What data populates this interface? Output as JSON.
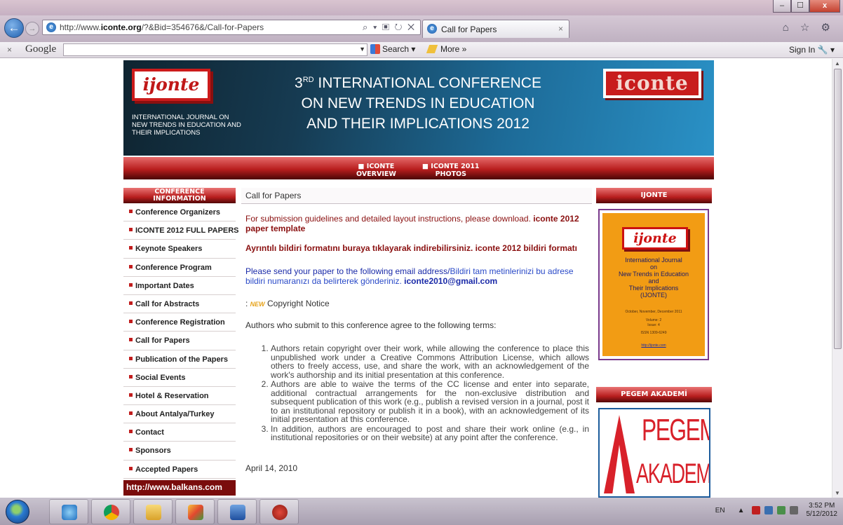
{
  "browser": {
    "url_prefix": "http://www.",
    "url_domain": "iconte.org",
    "url_rest": "/?&Bid=354676&/Call-for-Papers",
    "address_tools": "⌕ ▾ ▣ ↻ ✕",
    "tab_title": "Call for Papers",
    "tab_close": "×",
    "right_icons": "⌂ ☆ ⚙",
    "window_buttons": [
      "–",
      "☐",
      "x"
    ]
  },
  "google_toolbar": {
    "close": "×",
    "logo": "Google",
    "search_label": "Search ▾",
    "more_label": "More »",
    "sign_in": "Sign In 🔧 ▾"
  },
  "banner": {
    "ijonte_logo": "ijonte",
    "ijonte_subtitle": "INTERNATIONAL JOURNAL ON NEW TRENDS IN EDUCATION AND THEIR IMPLICATIONS",
    "title_prefix": "3",
    "title_sup": "RD",
    "title_line1": " INTERNATIONAL CONFERENCE",
    "title_line2": "ON NEW TRENDS IN EDUCATION",
    "title_line3": "AND THEIR IMPLICATIONS 2012",
    "iconte_logo": "iconte"
  },
  "menu": {
    "items": [
      {
        "line1": "■ ICONTE",
        "line2": "OVERVIEW"
      },
      {
        "line1": "■ ICONTE 2011",
        "line2": "PHOTOS"
      }
    ]
  },
  "sidebar": {
    "heading_line1": "CONFERENCE",
    "heading_line2": "INFORMATION",
    "items": [
      "Conference Organizers",
      "ICONTE 2012 FULL PAPERS",
      "Keynote Speakers",
      "Conference Program",
      "Important Dates",
      "Call for Abstracts",
      "Conference Registration",
      "Call for Papers",
      "Publication of the Papers",
      "Social Events",
      "Hotel & Reservation",
      "About Antalya/Turkey",
      "Contact",
      "Sponsors",
      "Accepted Papers"
    ],
    "footer": "http://www.balkans.com"
  },
  "main": {
    "panel_title": "Call for Papers",
    "p1_text": "For submission guidelines and detailed layout instructions, please download. ",
    "p1_link": "iconte 2012 paper template",
    "p2_text": "Ayrıntılı bildiri formatını buraya tıklayarak indirebilirsiniz. iconte 2012 bildiri formatı",
    "p3_text_a": "Please send your paper to the following email address/",
    "p3_text_b": "Bildiri tam metinlerinizi bu adrese bildiri numaranızı da belirterek gönderiniz. ",
    "p3_email": "iconte2010@gmail.com",
    "copyright_prefix": ": ",
    "copyright_new": "NEW",
    "copyright_label": " Copyright Notice",
    "agree_text": "Authors who submit to this conference agree to the following terms:",
    "terms": [
      "Authors retain copyright over their work, while allowing the conference to place this unpublished work under a Creative Commons Attribution License, which allows others to freely access, use, and share the work, with an acknowledgement of the work's authorship and its initial presentation at this conference.",
      "Authors are able to waive the terms of the CC license and enter into separate, additional contractual arrangements for the non-exclusive distribution and subsequent publication of this work (e.g., publish a revised version in a journal, post it to an institutional repository or publish it in a book), with an acknowledgement of its initial presentation at this conference.",
      "In addition, authors are encouraged to post and share their work online (e.g., in institutional repositories or on their website) at any point after the conference."
    ],
    "date": "April 14, 2010"
  },
  "right": {
    "ijonte_head": "IJONTE",
    "journal_logo": "ijonte",
    "journal_l1": "International Journal",
    "journal_l2": "on",
    "journal_l3": "New Trends in Education",
    "journal_l4": "and",
    "journal_l5": "Their Implications",
    "journal_l6": "(IJONTE)",
    "journal_issue": "October, November, December 2011",
    "journal_vol": "Volume: 2",
    "journal_iss": "Issue: 4",
    "journal_issn": "ISSN 1309-6249",
    "journal_url": "http://ijonte.com",
    "pegem_head": "PEGEM AKADEMİ",
    "pegem_t1": "PEGEM",
    "pegem_t2": "AKADEMİ"
  },
  "taskbar": {
    "lang": "EN",
    "time": "3:52 PM",
    "date": "5/12/2012",
    "tray_arrow": "▲"
  }
}
